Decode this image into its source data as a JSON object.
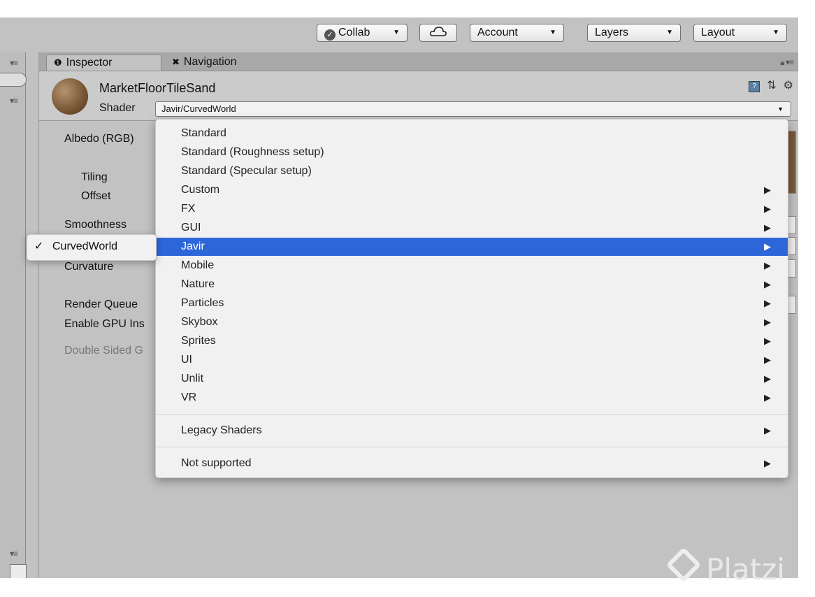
{
  "toolbar": {
    "collab_label": "Collab",
    "account_label": "Account",
    "layers_label": "Layers",
    "layout_label": "Layout"
  },
  "tabs": [
    {
      "label": "Inspector",
      "icon": "info-icon"
    },
    {
      "label": "Navigation",
      "icon": "navigation-icon"
    }
  ],
  "material": {
    "name": "MarketFloorTileSand",
    "shader_label": "Shader",
    "shader_value": "Javir/CurvedWorld"
  },
  "properties": {
    "albedo": "Albedo (RGB)",
    "tiling": "Tiling",
    "offset": "Offset",
    "smoothness": "Smoothness",
    "curvature": "Curvature",
    "render_queue": "Render Queue",
    "enable_gpu": "Enable GPU Ins",
    "double_sided": "Double Sided G"
  },
  "dropdown": {
    "items": [
      {
        "label": "Standard",
        "submenu": false
      },
      {
        "label": "Standard (Roughness setup)",
        "submenu": false
      },
      {
        "label": "Standard (Specular setup)",
        "submenu": false
      },
      {
        "label": "Custom",
        "submenu": true
      },
      {
        "label": "FX",
        "submenu": true
      },
      {
        "label": "GUI",
        "submenu": true
      },
      {
        "label": "Javir",
        "submenu": true,
        "selected": true
      },
      {
        "label": "Mobile",
        "submenu": true
      },
      {
        "label": "Nature",
        "submenu": true
      },
      {
        "label": "Particles",
        "submenu": true
      },
      {
        "label": "Skybox",
        "submenu": true
      },
      {
        "label": "Sprites",
        "submenu": true
      },
      {
        "label": "UI",
        "submenu": true
      },
      {
        "label": "Unlit",
        "submenu": true
      },
      {
        "label": "VR",
        "submenu": true
      }
    ],
    "legacy_label": "Legacy Shaders",
    "not_supported_label": "Not supported",
    "selected_color": "#2d66d9"
  },
  "submenu": {
    "check": "✓",
    "label": "CurvedWorld"
  },
  "watermark": "Platzi"
}
